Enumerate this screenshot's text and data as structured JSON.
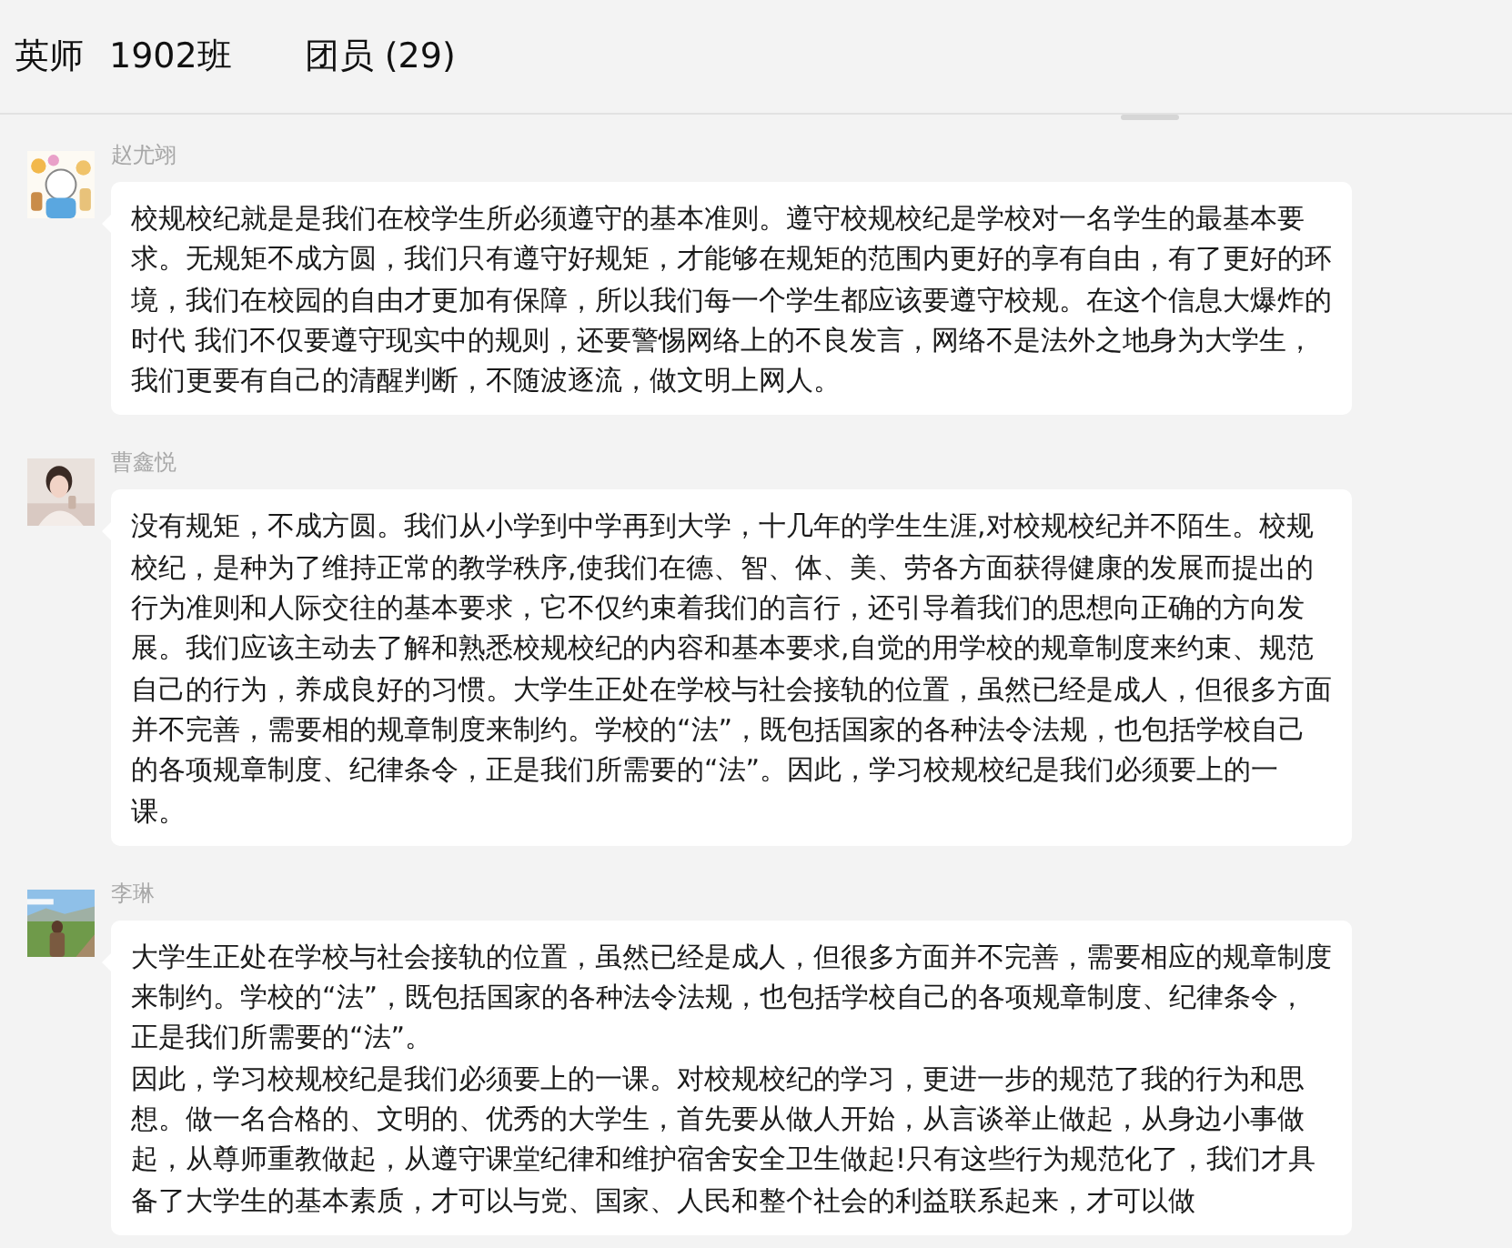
{
  "header": {
    "school": "英师",
    "group": "1902班",
    "members": "团员 (29)"
  },
  "messages": [
    {
      "sender": "赵尤翊",
      "paragraphs": [
        "校规校纪就是是我们在校学生所必须遵守的基本准则。遵守校规校纪是学校对一名学生的最基本要求。无规矩不成方圆，我们只有遵守好规矩，才能够在规矩的范围内更好的享有自由，有了更好的环境，我们在校园的自由才更加有保障，所以我们每一个学生都应该要遵守校规。在这个信息大爆炸的时代 我们不仅要遵守现实中的规则，还要警惕网络上的不良发言，网络不是法外之地身为大学生，我们更要有自己的清醒判断，不随波逐流，做文明上网人。"
      ]
    },
    {
      "sender": "曹鑫悦",
      "paragraphs": [
        "没有规矩，不成方圆。我们从小学到中学再到大学，十几年的学生生涯,对校规校纪并不陌生。校规校纪，是种为了维持正常的教学秩序,使我们在德、智、体、美、劳各方面获得健康的发展而提出的行为准则和人际交往的基本要求，它不仅约束着我们的言行，还引导着我们的思想向正确的方向发展。我们应该主动去了解和熟悉校规校纪的内容和基本要求,自觉的用学校的规章制度来约束、规范自己的行为，养成良好的习惯。大学生正处在学校与社会接轨的位置，虽然已经是成人，但很多方面并不完善，需要相的规章制度来制约。学校的“法”，既包括国家的各种法令法规，也包括学校自己的各项规章制度、纪律条令，正是我们所需要的“法”。因此，学习校规校纪是我们必须要上的一课。"
      ]
    },
    {
      "sender": "李琳",
      "paragraphs": [
        "大学生正处在学校与社会接轨的位置，虽然已经是成人，但很多方面并不完善，需要相应的规章制度来制约。学校的“法”，既包括国家的各种法令法规，也包括学校自己的各项规章制度、纪律条令，正是我们所需要的“法”。",
        "因此，学习校规校纪是我们必须要上的一课。对校规校纪的学习，更进一步的规范了我的行为和思想。做一名合格的、文明的、优秀的大学生，首先要从做人开始，从言谈举止做起，从身边小事做起，从尊师重教做起，从遵守课堂纪律和维护宿舍安全卫生做起!只有这些行为规范化了，我们才具备了大学生的基本素质，才可以与党、国家、人民和整个社会的利益联系起来，才可以做"
      ]
    }
  ]
}
